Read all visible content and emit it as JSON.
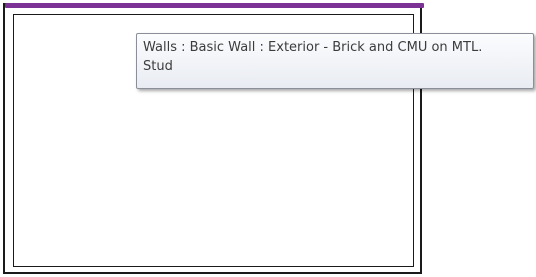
{
  "tooltip": {
    "line1": "Walls : Basic Wall : Exterior - Brick and CMU on MTL.",
    "line2": "Stud"
  },
  "colors": {
    "selection_highlight": "#7b3294",
    "wall_lines": "#1a1a1a",
    "tooltip_text": "#3c3c3c"
  }
}
